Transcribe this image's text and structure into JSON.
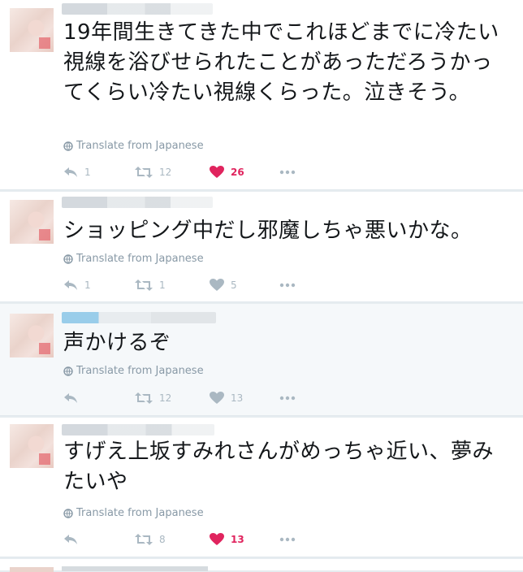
{
  "translate_label": "Translate from Japanese",
  "colors": {
    "like": "#e0245e",
    "muted": "#aab8c2",
    "link": "#8899a6"
  },
  "tweets": [
    {
      "text": "19年間生きてきた中でこれほどまでに冷たい視線を浴びせられたことがあっただろうかってくらい冷たい視線くらった。泣きそう。",
      "replies": "1",
      "retweets": "12",
      "likes": "26",
      "liked": true
    },
    {
      "text": "ショッピング中だし邪魔しちゃ悪いかな。",
      "replies": "1",
      "retweets": "1",
      "likes": "5",
      "liked": false
    },
    {
      "text": "声かけるぞ",
      "replies": "",
      "retweets": "12",
      "likes": "13",
      "liked": false
    },
    {
      "text": "すげえ上坂すみれさんがめっちゃ近い、夢みたいや",
      "replies": "",
      "retweets": "8",
      "likes": "13",
      "liked": true
    }
  ]
}
